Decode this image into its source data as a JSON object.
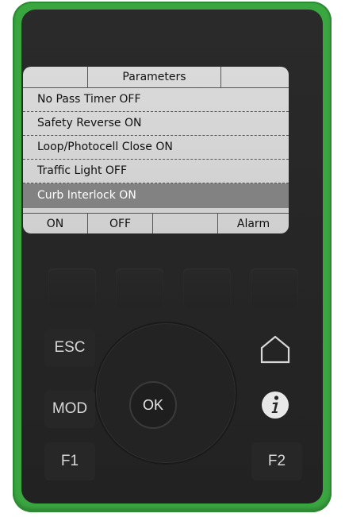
{
  "screen": {
    "title": "Parameters",
    "rows": [
      "No Pass Timer OFF",
      "Safety Reverse ON",
      "Loop/Photocell Close ON",
      "Traffic Light OFF",
      "Curb Interlock ON"
    ],
    "selected_row": "Curb Interlock ON",
    "softkeys": [
      "ON",
      "OFF",
      "",
      "Alarm"
    ]
  },
  "keypad": {
    "esc": "ESC",
    "mod": "MOD",
    "f1": "F1",
    "f2": "F2",
    "ok": "OK",
    "home_icon": "home-icon",
    "info_icon": "info-icon"
  },
  "colors": {
    "housing": "#3aa640",
    "panel": "#262626",
    "lcd": "#d4d4d4",
    "lcd_selected": "#828282"
  }
}
